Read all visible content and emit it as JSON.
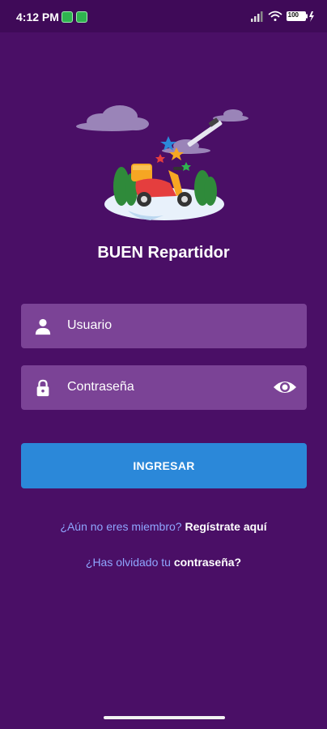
{
  "status_bar": {
    "time": "4:12 PM",
    "battery": "100"
  },
  "app": {
    "title": "BUEN Repartidor"
  },
  "login_form": {
    "username_placeholder": "Usuario",
    "password_placeholder": "Contraseña",
    "submit_label": "INGRESAR"
  },
  "links": {
    "register_prompt": "¿Aún no eres miembro?",
    "register_link": "Regístrate aquí",
    "forgot_prompt": "¿Has olvidado tu",
    "forgot_link": "contraseña?"
  },
  "colors": {
    "background": "#4a0f66",
    "field": "#7b4396",
    "button": "#2b88d9",
    "link_muted": "#8fa6ff"
  },
  "icons": {
    "user": "user-icon",
    "lock": "lock-icon",
    "eye": "eye-icon"
  }
}
